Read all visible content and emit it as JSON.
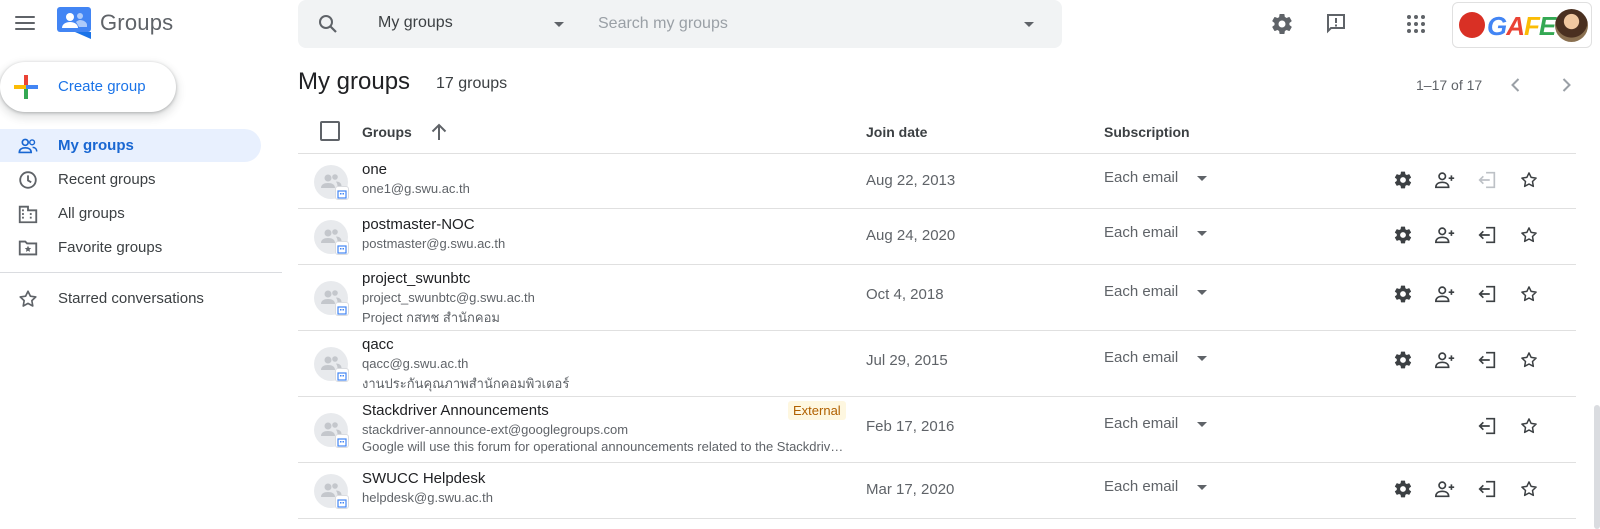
{
  "app": {
    "name": "Groups"
  },
  "search": {
    "scope": "My groups",
    "placeholder": "Search my groups"
  },
  "account": {
    "badge_text": "GAFE"
  },
  "sidebar": {
    "create_label": "Create group",
    "items": [
      {
        "label": "My groups",
        "icon": "people-icon",
        "active": true
      },
      {
        "label": "Recent groups",
        "icon": "clock-icon"
      },
      {
        "label": "All groups",
        "icon": "building-icon"
      },
      {
        "label": "Favorite groups",
        "icon": "star-folder-icon"
      },
      {
        "label": "Starred conversations",
        "icon": "star-icon"
      }
    ]
  },
  "main": {
    "title": "My groups",
    "count": "17 groups",
    "pagination": "1–17 of 17",
    "columns": {
      "groups": "Groups",
      "join_date": "Join date",
      "subscription": "Subscription"
    },
    "rows": [
      {
        "name": "one",
        "email": "one1@g.swu.ac.th",
        "description": "",
        "external": "",
        "join_date": "Aug 22, 2013",
        "subscription": "Each email",
        "actions": [
          "settings",
          "add-member",
          "leave-disabled",
          "star"
        ]
      },
      {
        "name": "postmaster-NOC",
        "email": "postmaster@g.swu.ac.th",
        "description": "",
        "external": "",
        "join_date": "Aug 24, 2020",
        "subscription": "Each email",
        "actions": [
          "settings",
          "add-member",
          "leave",
          "star"
        ]
      },
      {
        "name": "project_swunbtc",
        "email": "project_swunbtc@g.swu.ac.th",
        "description": "Project กสทช สำนักคอม",
        "external": "",
        "join_date": "Oct 4, 2018",
        "subscription": "Each email",
        "actions": [
          "settings",
          "add-member",
          "leave",
          "star"
        ]
      },
      {
        "name": "qacc",
        "email": "qacc@g.swu.ac.th",
        "description": "งานประกันคุณภาพสำนักคอมพิวเตอร์",
        "external": "",
        "join_date": "Jul 29, 2015",
        "subscription": "Each email",
        "actions": [
          "settings",
          "add-member",
          "leave",
          "star"
        ]
      },
      {
        "name": "Stackdriver Announcements",
        "email": "stackdriver-announce-ext@googlegroups.com",
        "description": "Google will use this forum for operational announcements related to the Stackdriver product line.",
        "external": "External",
        "join_date": "Feb 17, 2016",
        "subscription": "Each email",
        "actions": [
          "leave",
          "star"
        ]
      },
      {
        "name": "SWUCC Helpdesk",
        "email": "helpdesk@g.swu.ac.th",
        "description": "",
        "external": "",
        "join_date": "Mar 17, 2020",
        "subscription": "Each email",
        "actions": [
          "settings",
          "add-member",
          "leave",
          "star"
        ]
      }
    ]
  }
}
